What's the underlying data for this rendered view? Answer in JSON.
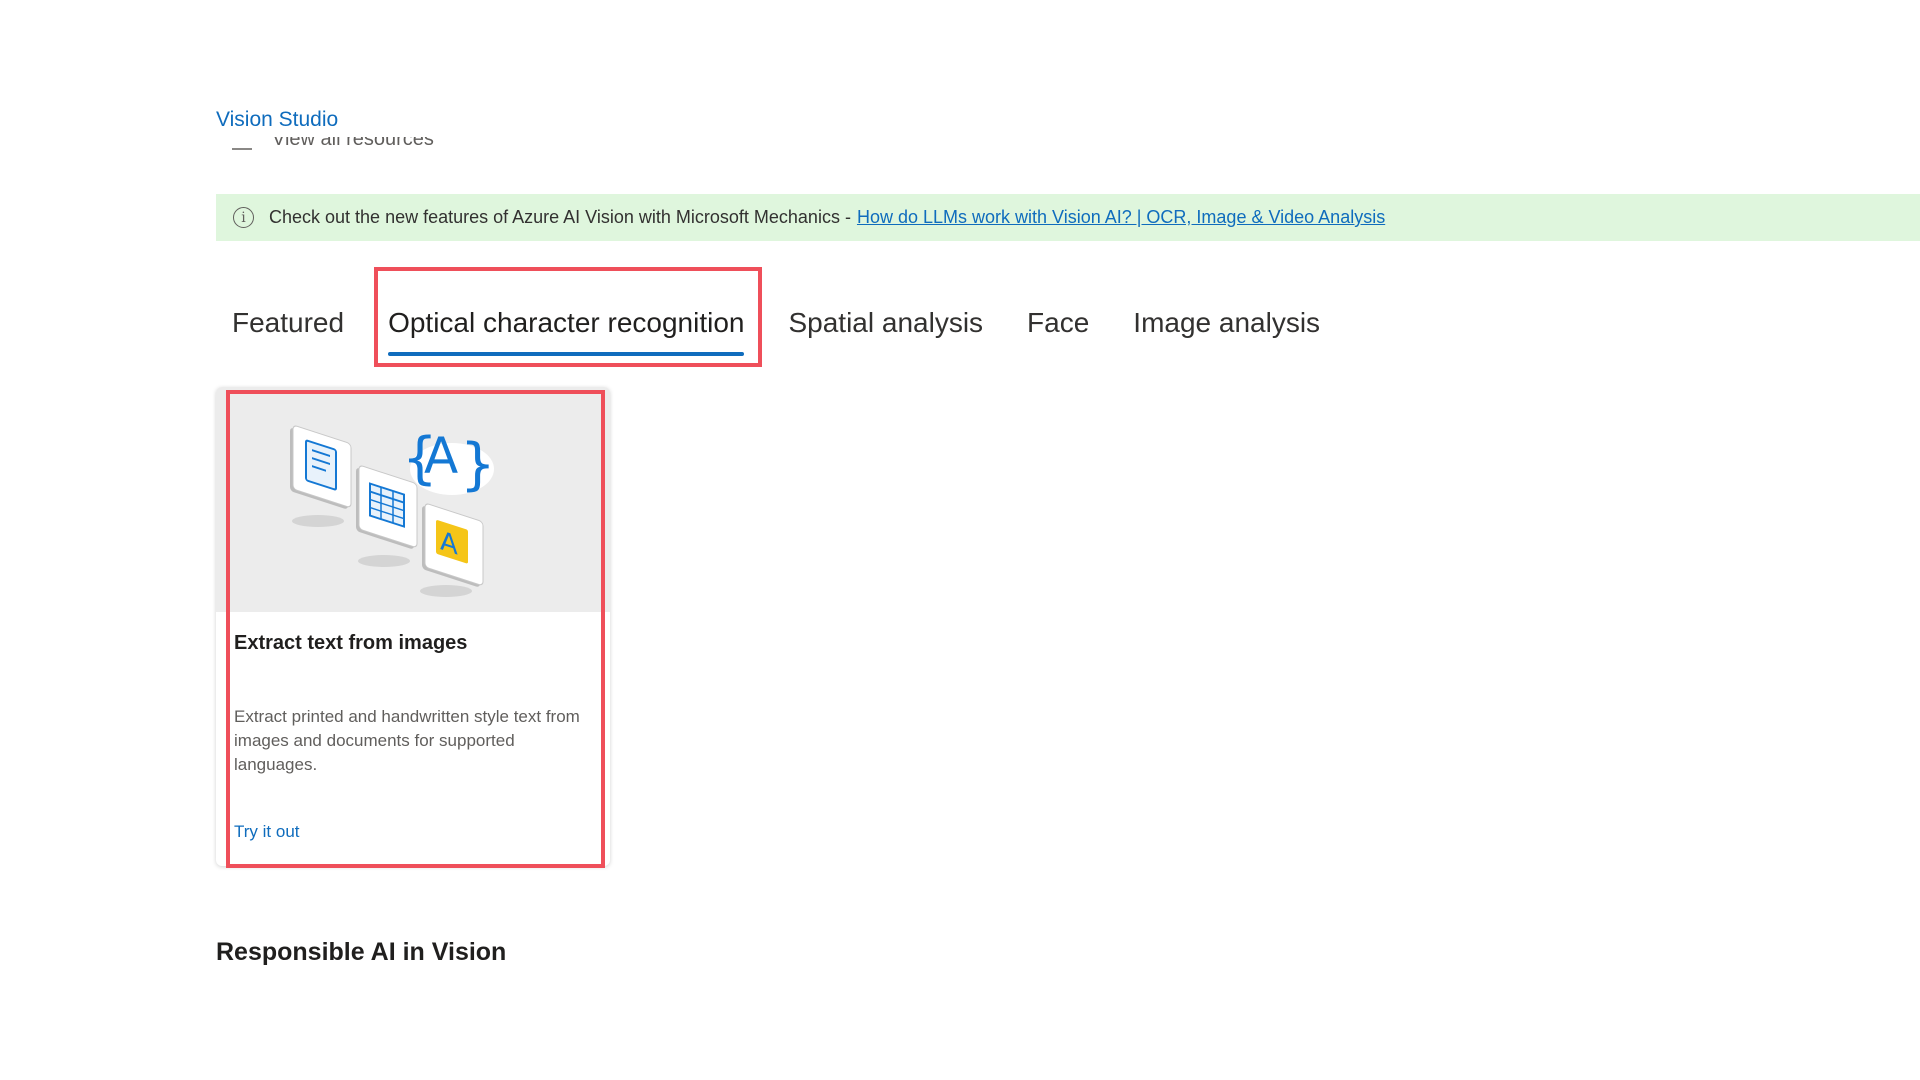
{
  "app": {
    "title": "Vision Studio"
  },
  "clipped_row": {
    "label": "View all resources"
  },
  "banner": {
    "text": "Check out the new features of Azure AI Vision with Microsoft Mechanics -",
    "link_text": "How do LLMs work with Vision AI? | OCR, Image & Video Analysis",
    "background": "#dff6dd"
  },
  "tabs": [
    {
      "label": "Featured",
      "active": false
    },
    {
      "label": "Optical character recognition",
      "active": true
    },
    {
      "label": "Spatial analysis",
      "active": false
    },
    {
      "label": "Face",
      "active": false
    },
    {
      "label": "Image analysis",
      "active": false
    }
  ],
  "card": {
    "title": "Extract text from images",
    "description": "Extract printed and handwritten style text from images and documents for supported languages.",
    "link": "Try it out",
    "hero_icon": "ocr-illustration-icon"
  },
  "section": {
    "heading": "Responsible AI in Vision"
  },
  "colors": {
    "accent": "#0f6cbd",
    "highlight": "#ef4f5a"
  }
}
